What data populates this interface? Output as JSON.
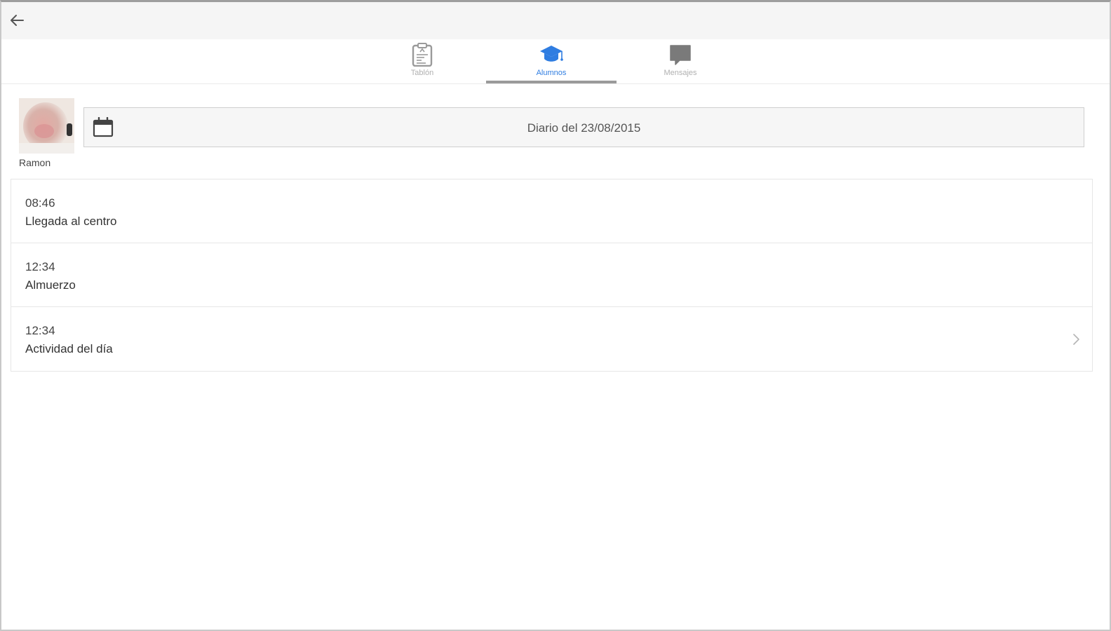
{
  "header": {
    "back_icon": "arrow-left-icon"
  },
  "tabs": [
    {
      "label": "Tablón",
      "icon": "clipboard-icon",
      "active": false
    },
    {
      "label": "Alumnos",
      "icon": "graduation-cap-icon",
      "active": true
    },
    {
      "label": "Mensajes",
      "icon": "chat-bubble-icon",
      "active": false
    }
  ],
  "student": {
    "name": "Ramon"
  },
  "date_selector": {
    "label": "Diario del 23/08/2015",
    "icon": "calendar-icon"
  },
  "entries": [
    {
      "time": "08:46",
      "label": "Llegada al centro"
    },
    {
      "time": "12:34",
      "label": "Almuerzo"
    },
    {
      "time": "12:34",
      "label": "Actividad del día",
      "has_chevron": true
    }
  ],
  "colors": {
    "accent": "#2f7de1",
    "tab_inactive": "#b0b0b0",
    "underline": "#9a9a9a",
    "topbar_bg": "#f5f5f5"
  }
}
